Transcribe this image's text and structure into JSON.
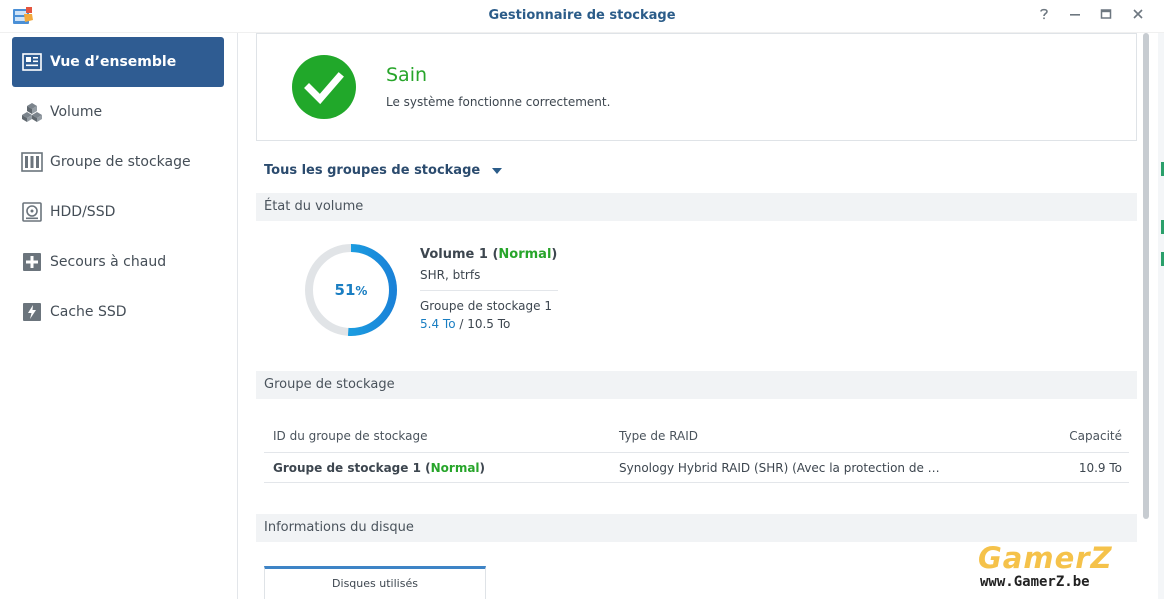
{
  "window": {
    "title": "Gestionnaire de stockage",
    "help_icon": "help-icon",
    "min_icon": "minimize-icon",
    "max_icon": "maximize-icon",
    "close_icon": "close-icon"
  },
  "sidebar": {
    "items": [
      {
        "label": "Vue d’ensemble",
        "icon": "overview-icon",
        "active": true
      },
      {
        "label": "Volume",
        "icon": "volume-icon",
        "active": false
      },
      {
        "label": "Groupe de stockage",
        "icon": "storage-pool-icon",
        "active": false
      },
      {
        "label": "HDD/SSD",
        "icon": "drive-icon",
        "active": false
      },
      {
        "label": "Secours à chaud",
        "icon": "hot-spare-icon",
        "active": false
      },
      {
        "label": "Cache SSD",
        "icon": "ssd-cache-icon",
        "active": false
      }
    ]
  },
  "status": {
    "title": "Sain",
    "description": "Le système fonctionne correctement.",
    "color": "#21a82a"
  },
  "group_filter": {
    "label": "Tous les groupes de stockage"
  },
  "volume_section": {
    "heading": "État du volume",
    "usage_percent": 51,
    "usage_label": "51",
    "usage_unit": "%",
    "volume_name": "Volume 1",
    "volume_state": "Normal",
    "volume_type": "SHR, btrfs",
    "pool": "Groupe de stockage 1",
    "used": "5.4 To",
    "separator": " / ",
    "total": "10.5 To"
  },
  "pool_section": {
    "heading": "Groupe de stockage",
    "columns": [
      "ID du groupe de stockage",
      "Type de RAID",
      "Capacité"
    ],
    "rows": [
      {
        "name": "Groupe de stockage 1",
        "state": "Normal",
        "raid": "Synology Hybrid RAID (SHR) (Avec la protection de …",
        "capacity": "10.9 To"
      }
    ]
  },
  "disk_section": {
    "heading": "Informations du disque",
    "tab": "Disques utilisés"
  },
  "watermark": {
    "brand": "GamerZ",
    "url": "www.GamerZ.be"
  },
  "colors": {
    "accent": "#2f5c92",
    "healthy": "#27a52a",
    "usage": "#1a9ede"
  }
}
